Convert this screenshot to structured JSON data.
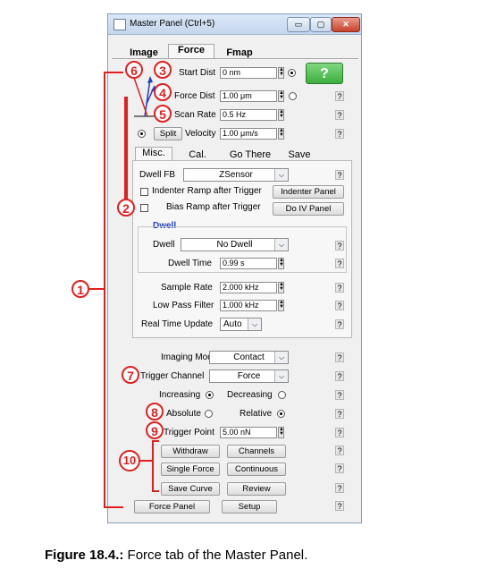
{
  "window": {
    "title": "Master Panel (Ctrl+5)",
    "controls": {
      "minimize": "▭",
      "maximize": "▢",
      "close": "✕"
    }
  },
  "top_tabs": [
    "Image",
    "Force",
    "Fmap"
  ],
  "top_section": {
    "start_dist": {
      "label": "Start Dist",
      "value": "0 nm"
    },
    "force_dist": {
      "label": "Force Dist",
      "value": "1.00 μm"
    },
    "scan_rate": {
      "label": "Scan Rate",
      "value": "0.5 Hz"
    },
    "split_button": "Split",
    "velocity": {
      "label": "Velocity",
      "value": "1.00 μm/s"
    },
    "go_button": "?"
  },
  "sub_tabs": [
    "Misc.",
    "Cal.",
    "Go There",
    "Save"
  ],
  "misc": {
    "dwell_fb": {
      "label": "Dwell FB",
      "value": "ZSensor"
    },
    "indenter_ramp": {
      "label": "Indenter Ramp after Trigger",
      "button": "Indenter Panel"
    },
    "bias_ramp": {
      "label": "Bias Ramp after Trigger",
      "button": "Do IV Panel"
    },
    "dwell_group_title": "Dwell",
    "dwell": {
      "label": "Dwell",
      "value": "No Dwell"
    },
    "dwell_time": {
      "label": "Dwell Time",
      "value": "0.99 s"
    },
    "sample_rate": {
      "label": "Sample Rate",
      "value": "2.000 kHz"
    },
    "low_pass": {
      "label": "Low Pass Filter",
      "value": "1.000 kHz"
    },
    "real_time": {
      "label": "Real Time Update",
      "value": "Auto"
    }
  },
  "bottom": {
    "imaging_mode": {
      "label": "Imaging Mode",
      "value": "Contact"
    },
    "trigger_channel": {
      "label": "Trigger Channel",
      "value": "Force"
    },
    "increasing": "Increasing",
    "decreasing": "Decreasing",
    "absolute": "Absolute",
    "relative": "Relative",
    "trigger_point": {
      "label": "Trigger Point",
      "value": "5.00 nN"
    },
    "buttons": {
      "withdraw": "Withdraw",
      "channels": "Channels",
      "single_force": "Single Force",
      "continuous": "Continuous",
      "save_curve": "Save Curve",
      "review": "Review",
      "force_panel": "Force Panel",
      "setup": "Setup"
    }
  },
  "help_symbol": "?",
  "callouts": [
    "1",
    "2",
    "3",
    "4",
    "5",
    "6",
    "7",
    "8",
    "9",
    "10"
  ],
  "caption": {
    "label": "Figure 18.4.:",
    "text": " Force tab of the Master Panel."
  },
  "colors": {
    "annotation_red": "#e02020",
    "go_button_green": "#3cae3c",
    "dwell_title_blue": "#1f3fbf"
  }
}
